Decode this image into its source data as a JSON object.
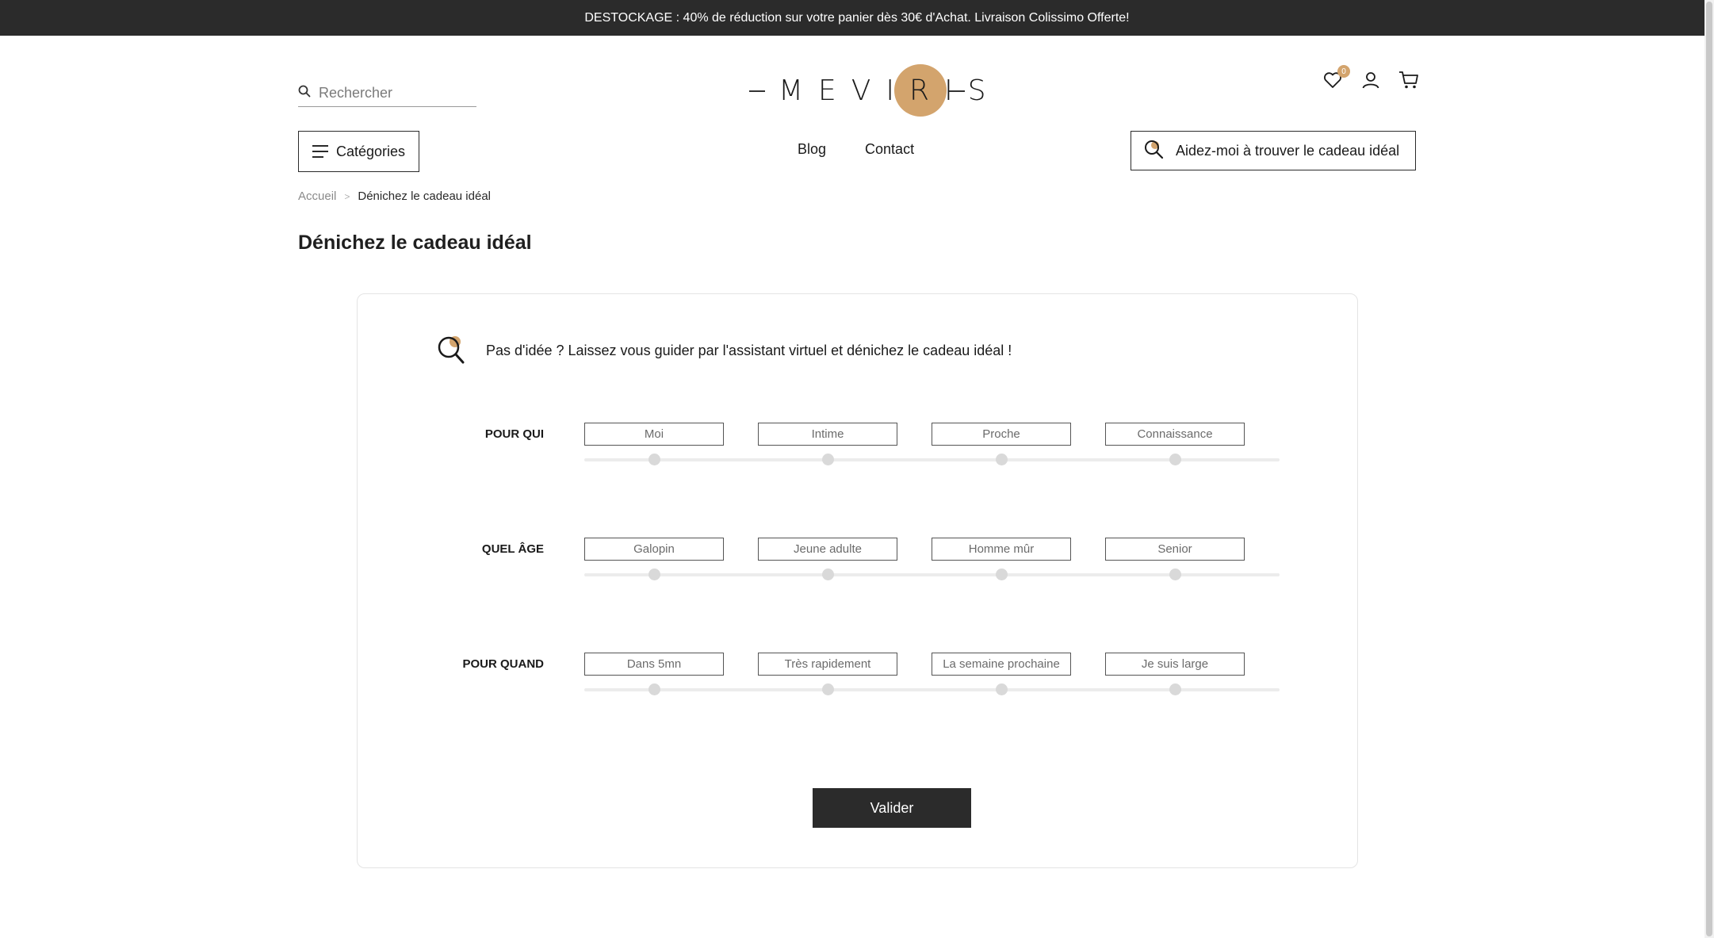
{
  "banner": {
    "text": "DESTOCKAGE : 40% de réduction sur votre panier dès 30€ d'Achat. Livraison Colissimo Offerte!"
  },
  "header": {
    "search_placeholder": "Rechercher",
    "logo_text": "MEVIRIS",
    "wishlist_count": "0",
    "categories_label": "Catégories",
    "nav": [
      "Blog",
      "Contact"
    ],
    "helper_button_label": "Aidez-moi à trouver le cadeau idéal"
  },
  "breadcrumb": {
    "home": "Accueil",
    "separator": ">",
    "current": "Dénichez le cadeau idéal"
  },
  "page_title": "Dénichez le cadeau idéal",
  "wizard": {
    "intro": "Pas d'idée ? Laissez vous guider par l'assistant virtuel et dénichez le cadeau idéal !",
    "questions": [
      {
        "label": "POUR QUI",
        "options": [
          "Moi",
          "Intime",
          "Proche",
          "Connaissance"
        ]
      },
      {
        "label": "QUEL ÂGE",
        "options": [
          "Galopin",
          "Jeune adulte",
          "Homme mûr",
          "Senior"
        ]
      },
      {
        "label": "POUR QUAND",
        "options": [
          "Dans 5mn",
          "Très rapidement",
          "La semaine prochaine",
          "Je suis large"
        ]
      }
    ],
    "submit_label": "Valider"
  },
  "colors": {
    "brand_gold": "#d3a46d",
    "dark": "#2b2b2b",
    "slider_dot": "#d9d9d9"
  },
  "icons": [
    "search-icon",
    "heart-icon",
    "user-icon",
    "cart-icon",
    "hamburger-icon",
    "magnifier-icon"
  ]
}
